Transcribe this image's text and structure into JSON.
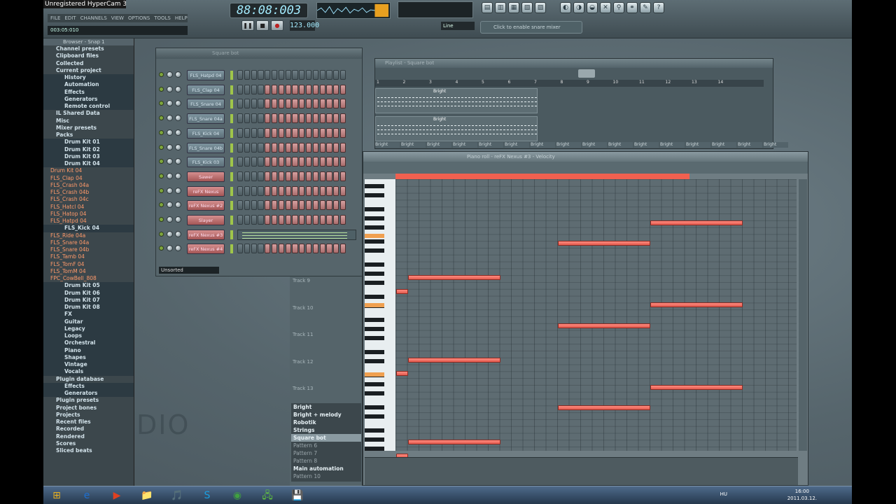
{
  "hypercam_title": "Unregistered HyperCam 3",
  "menu": [
    "FILE",
    "EDIT",
    "CHANNELS",
    "VIEW",
    "OPTIONS",
    "TOOLS",
    "HELP"
  ],
  "song_position": "003:05:010",
  "time_display": "88:08:003",
  "tempo": "123.000",
  "line_mode": "Line",
  "hint_text": "Click to enable snare mixer",
  "transport": {
    "pause": "❚❚",
    "stop": "■",
    "record": "●"
  },
  "browser": {
    "title": "Browser - Snap 1",
    "items": [
      {
        "label": "Channel presets",
        "kind": "folder"
      },
      {
        "label": "Clipboard files",
        "kind": "folder"
      },
      {
        "label": "Collected",
        "kind": "folder"
      },
      {
        "label": "Current project",
        "kind": "folder"
      },
      {
        "label": "History",
        "kind": "sub"
      },
      {
        "label": "Automation",
        "kind": "sub"
      },
      {
        "label": "Effects",
        "kind": "sub"
      },
      {
        "label": "Generators",
        "kind": "sub"
      },
      {
        "label": "Remote control",
        "kind": "sub"
      },
      {
        "label": "IL Shared Data",
        "kind": "folder"
      },
      {
        "label": "Misc",
        "kind": "folder"
      },
      {
        "label": "Mixer presets",
        "kind": "folder"
      },
      {
        "label": "Packs",
        "kind": "folder"
      },
      {
        "label": "Drum Kit 01",
        "kind": "sub"
      },
      {
        "label": "Drum Kit 02",
        "kind": "sub"
      },
      {
        "label": "Drum Kit 03",
        "kind": "sub"
      },
      {
        "label": "Drum Kit 04",
        "kind": "sub"
      },
      {
        "label": "Drum Kit 04",
        "kind": "file"
      },
      {
        "label": "FLS_Clap 04",
        "kind": "file"
      },
      {
        "label": "FLS_Crash 04a",
        "kind": "file"
      },
      {
        "label": "FLS_Crash 04b",
        "kind": "file"
      },
      {
        "label": "FLS_Crash 04c",
        "kind": "file"
      },
      {
        "label": "FLS_Hatcl 04",
        "kind": "file"
      },
      {
        "label": "FLS_Hatop 04",
        "kind": "file"
      },
      {
        "label": "FLS_Hatpd 04",
        "kind": "file"
      },
      {
        "label": "FLS_Kick 04",
        "kind": "sub"
      },
      {
        "label": "FLS_Ride 04a",
        "kind": "file"
      },
      {
        "label": "FLS_Snare 04a",
        "kind": "file"
      },
      {
        "label": "FLS_Snare 04b",
        "kind": "file"
      },
      {
        "label": "FLS_Tamb 04",
        "kind": "file"
      },
      {
        "label": "FLS_TomF 04",
        "kind": "file"
      },
      {
        "label": "FLS_TomM 04",
        "kind": "file"
      },
      {
        "label": "FPC_CowBell_808",
        "kind": "file"
      },
      {
        "label": "Drum Kit 05",
        "kind": "sub"
      },
      {
        "label": "Drum Kit 06",
        "kind": "sub"
      },
      {
        "label": "Drum Kit 07",
        "kind": "sub"
      },
      {
        "label": "Drum Kit 08",
        "kind": "sub"
      },
      {
        "label": "FX",
        "kind": "sub"
      },
      {
        "label": "Guitar",
        "kind": "sub"
      },
      {
        "label": "Legacy",
        "kind": "sub"
      },
      {
        "label": "Loops",
        "kind": "sub"
      },
      {
        "label": "Orchestral",
        "kind": "sub"
      },
      {
        "label": "Piano",
        "kind": "sub"
      },
      {
        "label": "Shapes",
        "kind": "sub"
      },
      {
        "label": "Vintage",
        "kind": "sub"
      },
      {
        "label": "Vocals",
        "kind": "sub"
      },
      {
        "label": "Plugin database",
        "kind": "folder"
      },
      {
        "label": "Effects",
        "kind": "sub"
      },
      {
        "label": "Generators",
        "kind": "sub"
      },
      {
        "label": "Plugin presets",
        "kind": "folder"
      },
      {
        "label": "Project bones",
        "kind": "folder"
      },
      {
        "label": "Projects",
        "kind": "folder"
      },
      {
        "label": "Recent files",
        "kind": "folder"
      },
      {
        "label": "Recorded",
        "kind": "folder"
      },
      {
        "label": "Rendered",
        "kind": "folder"
      },
      {
        "label": "Scores",
        "kind": "folder"
      },
      {
        "label": "Sliced beats",
        "kind": "folder"
      }
    ]
  },
  "channel_rack": {
    "title": "Square bot",
    "filter": "Unsorted",
    "channels": [
      {
        "name": "FLS_Hatpd 04",
        "style": "blue",
        "steps": "gggggggggggggggg"
      },
      {
        "name": "FLS_Clap 04",
        "style": "blue",
        "steps": "ggggrrrrrrrrrrrr"
      },
      {
        "name": "FLS_Snare 04",
        "style": "blue",
        "steps": "ggggrrrrrrrrrrrr"
      },
      {
        "name": "FLS_Snare 04a",
        "style": "blue",
        "steps": "ggggrrrrrrrrrrrr"
      },
      {
        "name": "FLS_Kick 04",
        "style": "blue",
        "steps": "ggggrrrrrrrrrrrr"
      },
      {
        "name": "FLS_Snare 04b",
        "style": "blue",
        "steps": "ggggrrrrrrrrrrrr"
      },
      {
        "name": "FLS_Kick 03",
        "style": "blue",
        "steps": "ggggrrrrrrrrrrrr"
      },
      {
        "name": "Sawer",
        "style": "red",
        "steps": "ggggrrrrrrrrrrrr"
      },
      {
        "name": "reFX Nexus",
        "style": "red",
        "steps": "ggggrrrrrrrrrrrr"
      },
      {
        "name": "reFX Nexus #2",
        "style": "red",
        "steps": "ggggrrrrrrrrrrrr"
      },
      {
        "name": "Slayer",
        "style": "red",
        "steps": "ggggrrrrrrrrrrrr"
      },
      {
        "name": "reFX Nexus #3",
        "style": "red",
        "steps": "piano"
      },
      {
        "name": "reFX Nexus #4",
        "style": "red",
        "steps": "ggggrrrrrrrrrrrr"
      }
    ]
  },
  "playlist": {
    "title": "Playlist - Square bot",
    "bars": [
      "1",
      "2",
      "3",
      "4",
      "5",
      "6",
      "7",
      "8",
      "9",
      "10",
      "11",
      "12",
      "13",
      "14"
    ],
    "clip_label": "Bright"
  },
  "tracks": [
    "Track 9",
    "Track 10",
    "Track 11",
    "Track 12",
    "Track 13"
  ],
  "patterns": [
    {
      "label": "Bright",
      "state": "normal"
    },
    {
      "label": "Bright + melody",
      "state": "normal"
    },
    {
      "label": "Robotik",
      "state": "normal"
    },
    {
      "label": "Strings",
      "state": "normal"
    },
    {
      "label": "Square bot",
      "state": "selected"
    },
    {
      "label": "Pattern 6",
      "state": "dim"
    },
    {
      "label": "Pattern 7",
      "state": "dim"
    },
    {
      "label": "Pattern 8",
      "state": "dim"
    },
    {
      "label": "Main automation",
      "state": "normal"
    },
    {
      "label": "Pattern 10",
      "state": "dim"
    }
  ],
  "piano_roll": {
    "title": "Piano roll - reFX Nexus #3 - Velocity",
    "notes": [
      {
        "start": 22,
        "len": 8,
        "row": 6
      },
      {
        "start": 14,
        "len": 8,
        "row": 9
      },
      {
        "start": 1,
        "len": 8,
        "row": 14
      },
      {
        "start": 0,
        "len": 1,
        "row": 16
      },
      {
        "start": 22,
        "len": 8,
        "row": 18
      },
      {
        "start": 14,
        "len": 8,
        "row": 21
      },
      {
        "start": 1,
        "len": 8,
        "row": 26
      },
      {
        "start": 0,
        "len": 1,
        "row": 28
      },
      {
        "start": 22,
        "len": 8,
        "row": 30
      },
      {
        "start": 14,
        "len": 8,
        "row": 33
      },
      {
        "start": 1,
        "len": 8,
        "row": 38
      },
      {
        "start": 0,
        "len": 1,
        "row": 40
      }
    ]
  },
  "taskbar": {
    "apps": [
      "⊞",
      "e",
      "▶",
      "📁",
      "🎵",
      "S",
      "◉",
      "🖧",
      "💾"
    ],
    "lang": "HU",
    "time": "16:00",
    "date": "2011.03.12."
  },
  "colors": {
    "accent": "#f06050",
    "note": "#ff8c80",
    "brand": "#5d6d74"
  }
}
